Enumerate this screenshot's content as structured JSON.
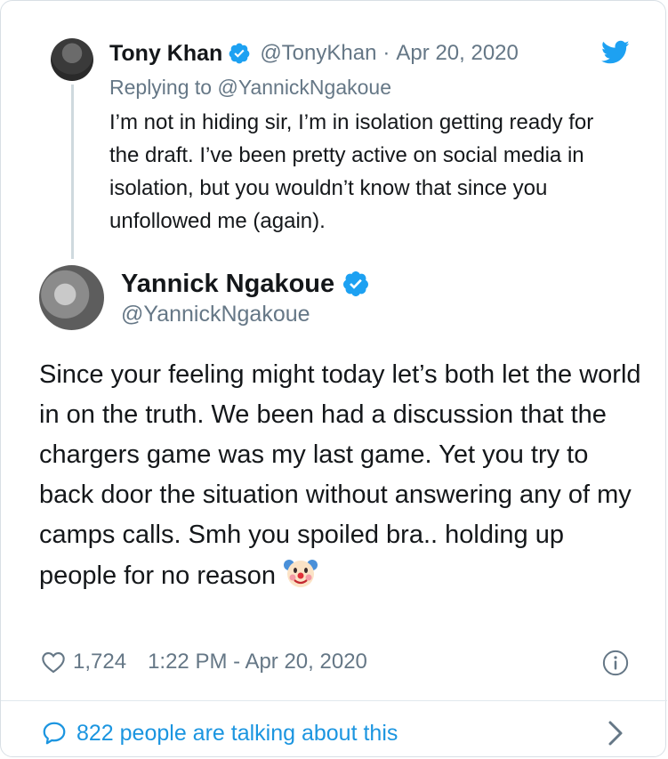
{
  "parent_tweet": {
    "display_name": "Tony Khan",
    "handle": "@TonyKhan",
    "separator": "·",
    "date": "Apr 20, 2020",
    "replying_to_label": "Replying to",
    "replying_to_handle": "@YannickNgakoue",
    "text": "I’m not in hiding sir, I’m in isolation getting ready for the draft. I’ve been pretty active on social media in isolation, but you wouldn’t know that since you unfollowed me (again)."
  },
  "main_tweet": {
    "display_name": "Yannick Ngakoue",
    "handle": "@YannickNgakoue",
    "text": "Since your feeling might today let’s both let the world in on the truth. We been had a discussion that the chargers game was my last game. Yet you try to back door the situation without answering any of my camps calls. Smh you spoiled bra.. holding up people for no reason",
    "emoji_name": "clown-face",
    "likes": "1,724",
    "timestamp": "1:22 PM - Apr 20, 2020"
  },
  "footer": {
    "talking_text": "822 people are talking about this"
  },
  "colors": {
    "verified": "#1da1f2",
    "twitter_blue": "#1da1f2",
    "link_blue": "#1b95e0",
    "muted": "#657786",
    "text": "#14171a"
  },
  "icons": [
    "twitter-bird-icon",
    "verified-badge-icon",
    "heart-icon",
    "info-icon",
    "speech-bubble-icon",
    "chevron-right-icon"
  ]
}
